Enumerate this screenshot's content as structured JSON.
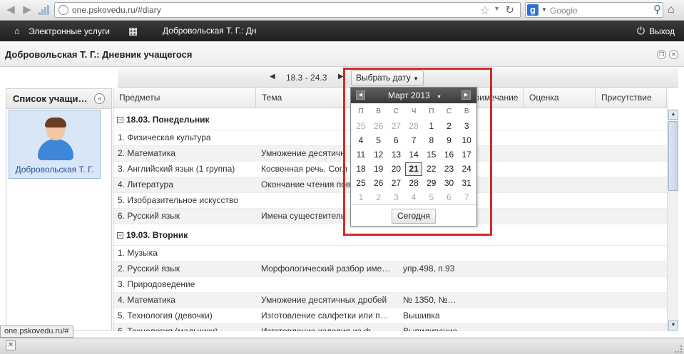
{
  "browser": {
    "url": "one.pskovedu.ru/#diary",
    "search_placeholder": "Google",
    "search_engine_letter": "g",
    "status_url": "one.pskovedu.ru/#"
  },
  "header": {
    "services": "Электронные услуги",
    "user": "Добровольская Т. Г.: Дн",
    "logout": "Выход"
  },
  "page": {
    "title": "Добровольская Т. Г.: Дневник учащегося"
  },
  "left_panel": {
    "title": "Список учащи…",
    "student_name": "Добровольская Т. Г."
  },
  "toolbar": {
    "date_range": "18.3 - 24.3",
    "pick_date": "Выбрать дату"
  },
  "columns": [
    "Предметы",
    "Тема",
    "Примечание",
    "Оценка",
    "Присутствие"
  ],
  "days": [
    {
      "label": "18.03. Понедельник",
      "rows": [
        {
          "subject": "1. Физическая культура",
          "topic": "",
          "hw": ""
        },
        {
          "subject": "2. Математика",
          "topic": "Умножение десятичн",
          "hw": ""
        },
        {
          "subject": "3. Английский язык (1 группа)",
          "topic": "Косвенная речь. Согл",
          "hw": ""
        },
        {
          "subject": "4. Литература",
          "topic": "Окончание чтения пов",
          "hw": ""
        },
        {
          "subject": "5. Изобразительное искусство",
          "topic": "",
          "hw": ""
        },
        {
          "subject": "6. Русский язык",
          "topic": "Имена существитель",
          "hw": ""
        }
      ]
    },
    {
      "label": "19.03. Вторник",
      "rows": [
        {
          "subject": "1. Музыка",
          "topic": "",
          "hw": ""
        },
        {
          "subject": "2. Русский язык",
          "topic": "Морфологический разбор име…",
          "hw": "упр.498, п.93"
        },
        {
          "subject": "3. Природоведение",
          "topic": "",
          "hw": ""
        },
        {
          "subject": "4. Математика",
          "topic": "Умножение десятичных дробей",
          "hw": "№ 1350, №…"
        },
        {
          "subject": "5. Технология (девочки)",
          "topic": "Изготовление салфетки или п…",
          "hw": "Вышивка"
        },
        {
          "subject": "6. Технология (мальчики)",
          "topic": "Изготовление изделия из ф…",
          "hw": "Выпиливание"
        }
      ]
    }
  ],
  "calendar": {
    "month": "Март 2013",
    "weekdays": [
      "П",
      "В",
      "С",
      "Ч",
      "П",
      "С",
      "В"
    ],
    "weeks": [
      [
        "25",
        "26",
        "27",
        "28",
        "1",
        "2",
        "3"
      ],
      [
        "4",
        "5",
        "6",
        "7",
        "8",
        "9",
        "10"
      ],
      [
        "11",
        "12",
        "13",
        "14",
        "15",
        "16",
        "17"
      ],
      [
        "18",
        "19",
        "20",
        "21",
        "22",
        "23",
        "24"
      ],
      [
        "25",
        "26",
        "27",
        "28",
        "29",
        "30",
        "31"
      ],
      [
        "1",
        "2",
        "3",
        "4",
        "5",
        "6",
        "7"
      ]
    ],
    "selected": "21",
    "today_button": "Сегодня"
  }
}
